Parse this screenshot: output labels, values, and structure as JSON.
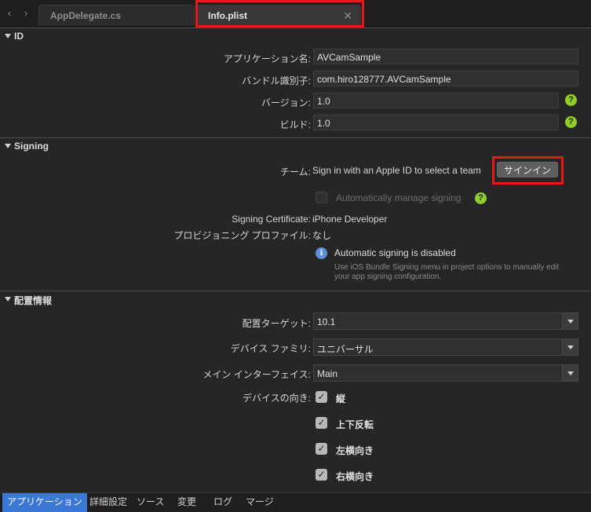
{
  "tabs": [
    {
      "label": "AppDelegate.cs",
      "active": false
    },
    {
      "label": "Info.plist",
      "active": true
    }
  ],
  "sections": {
    "id": {
      "title": "ID",
      "app_name_label": "アプリケーション名:",
      "app_name_value": "AVCamSample",
      "bundle_id_label": "バンドル識別子:",
      "bundle_id_value": "com.hiro128777.AVCamSample",
      "version_label": "バージョン:",
      "version_value": "1.0",
      "build_label": "ビルド:",
      "build_value": "1.0"
    },
    "signing": {
      "title": "Signing",
      "team_label": "チーム:",
      "team_value": "Sign in with an Apple ID to select a team",
      "sign_in_button": "サインイン",
      "auto_manage_label": "Automatically manage signing",
      "auto_manage_checked": false,
      "cert_label": "Signing Certificate:",
      "cert_value": "iPhone Developer",
      "profile_label": "プロビジョニング プロファイル:",
      "profile_value": "なし",
      "info_title": "Automatic signing is disabled",
      "info_desc": "Use iOS Bundle Signing menu in project options to manually edit your app signing configuration."
    },
    "deployment": {
      "title": "配置情報",
      "target_label": "配置ターゲット:",
      "target_value": "10.1",
      "family_label": "デバイス ファミリ:",
      "family_value": "ユニバーサル",
      "interface_label": "メイン インターフェイス:",
      "interface_value": "Main",
      "orientation_label": "デバイスの向き:",
      "orientations": [
        {
          "label": "縦",
          "checked": true
        },
        {
          "label": "上下反転",
          "checked": true
        },
        {
          "label": "左横向き",
          "checked": true
        },
        {
          "label": "右横向き",
          "checked": true
        }
      ]
    }
  },
  "bottom_tabs": [
    {
      "label": "アプリケーション",
      "active": true
    },
    {
      "label": "詳細設定",
      "active": false
    },
    {
      "label": "ソース",
      "active": false
    },
    {
      "label": "変更",
      "active": false
    },
    {
      "label": "ログ",
      "active": false
    },
    {
      "label": "マージ",
      "active": false
    }
  ],
  "icons": {
    "help": "help-icon",
    "info": "info-icon",
    "nav_back": "chevron-left-icon",
    "nav_forward": "chevron-right-icon",
    "close": "close-icon"
  },
  "colors": {
    "highlight": "#e01b1b",
    "help_green": "#8fce2a",
    "info_blue": "#5b8fd8",
    "active_tab_blue": "#3b78d6"
  }
}
